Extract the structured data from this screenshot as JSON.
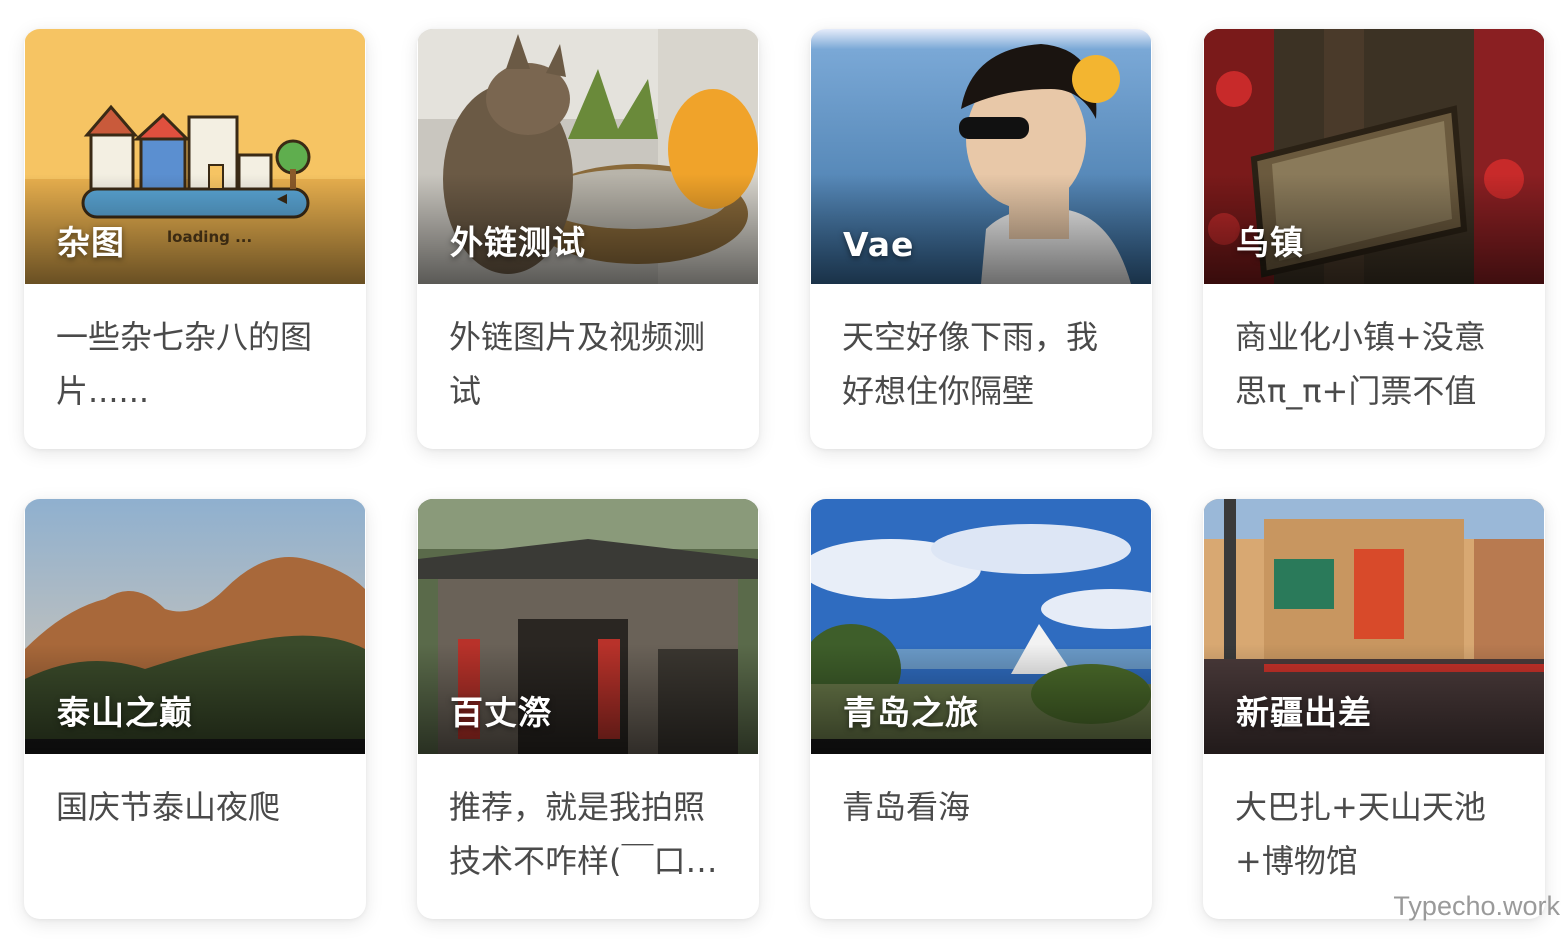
{
  "cards": [
    {
      "title": "杂图",
      "desc": "一些杂七杂八的图片......",
      "loading_text": "loading ..."
    },
    {
      "title": "外链测试",
      "desc": "外链图片及视频测试"
    },
    {
      "title": "Vae",
      "desc": "天空好像下雨，我好想住你隔壁"
    },
    {
      "title": "乌镇",
      "desc": "商业化小镇+没意思π_π+门票不值"
    },
    {
      "title": "泰山之巅",
      "desc": "国庆节泰山夜爬"
    },
    {
      "title": "百丈漈",
      "desc": "推荐，就是我拍照技术不咋样(￣口￣)"
    },
    {
      "title": "青岛之旅",
      "desc": "青岛看海"
    },
    {
      "title": "新疆出差",
      "desc": "大巴扎+天山天池+博物馆"
    }
  ],
  "watermark": "Typecho.work"
}
